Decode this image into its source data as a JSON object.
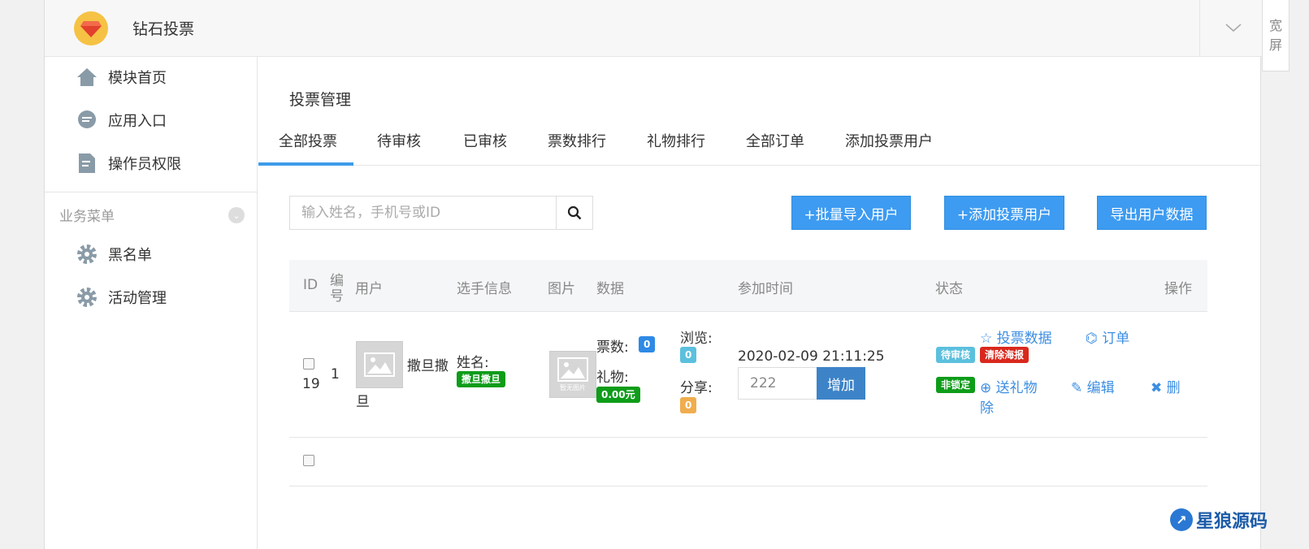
{
  "header": {
    "app_title": "钻石投票",
    "wide_label_1": "宽",
    "wide_label_2": "屏"
  },
  "sidebar": {
    "items": [
      {
        "label": "模块首页",
        "icon": "home-icon"
      },
      {
        "label": "应用入口",
        "icon": "chat-icon"
      },
      {
        "label": "操作员权限",
        "icon": "document-icon"
      }
    ],
    "group_label": "业务菜单",
    "group_items": [
      {
        "label": "黑名单",
        "icon": "gear-icon"
      },
      {
        "label": "活动管理",
        "icon": "gear-icon"
      }
    ]
  },
  "main": {
    "page_title": "投票管理",
    "tabs": [
      "全部投票",
      "待审核",
      "已审核",
      "票数排行",
      "礼物排行",
      "全部订单",
      "添加投票用户"
    ],
    "active_tab": 0,
    "search": {
      "placeholder": "输入姓名，手机号或ID"
    },
    "buttons": {
      "batch_import": "+批量导入用户",
      "add_vote_user": "+添加投票用户",
      "export_data": "导出用户数据"
    },
    "table": {
      "headers": {
        "id": "ID",
        "number_1": "编",
        "number_2": "号",
        "user": "用户",
        "player_info": "选手信息",
        "image": "图片",
        "data": "数据",
        "join_time": "参加时间",
        "status": "状态",
        "actions": "操作"
      },
      "rows": [
        {
          "id": "19",
          "number": "1",
          "user_name_line1": "撒旦撒",
          "user_name_line2": "旦",
          "image_caption": "暂无图片",
          "name_label": "姓名:",
          "name_value": "撒旦撒旦",
          "votes_label": "票数:",
          "votes_value": "0",
          "gift_label": "礼物:",
          "gift_value": "0.00元",
          "views_label": "浏览:",
          "views_value": "0",
          "share_label": "分享:",
          "share_value": "0",
          "join_time": "2020-02-09 21:11:25",
          "add_amount": "222",
          "add_button": "增加",
          "status_pending": "待审核",
          "status_clear": "清除海报",
          "status_unlocked": "非锁定",
          "action_vote_data": "投票数据",
          "action_orders": "订单",
          "action_send_gift_1": "送礼物",
          "action_send_gift_2": "除",
          "action_edit": "编辑",
          "action_delete": "删"
        }
      ]
    }
  },
  "watermark": "星狼源码",
  "colors": {
    "accent": "#3d9bf1",
    "green": "#0e9c19",
    "red": "#d9281c",
    "cyan": "#5bc0de",
    "orange": "#f0ad4e"
  }
}
